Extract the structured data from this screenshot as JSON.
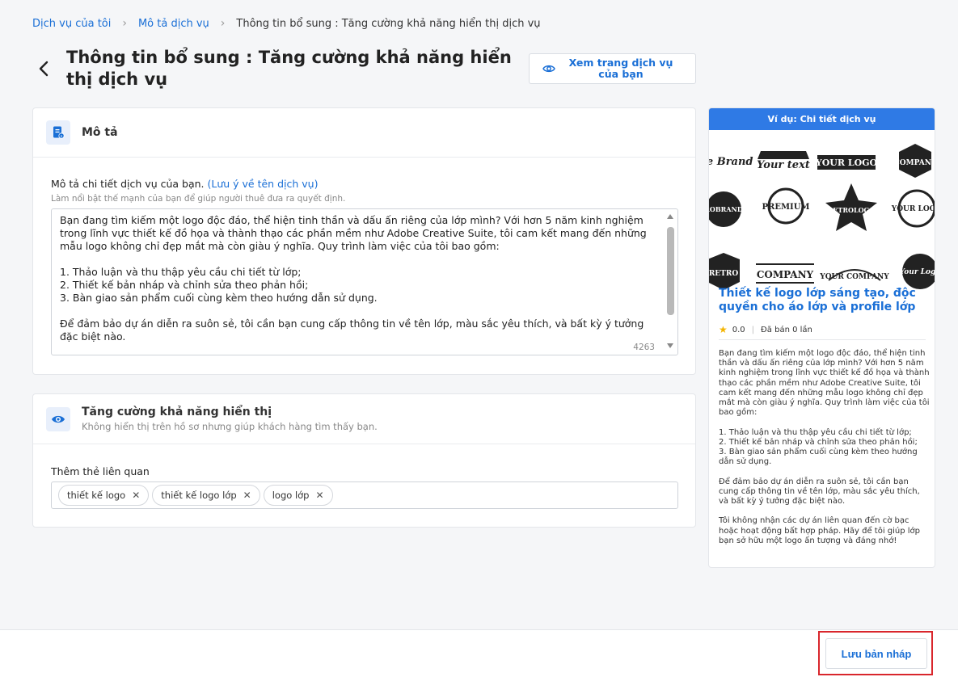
{
  "breadcrumb": {
    "item1": "Dịch vụ của tôi",
    "item2": "Mô tả dịch vụ",
    "current": "Thông tin bổ sung : Tăng cường khả năng hiển thị dịch vụ"
  },
  "header": {
    "title": "Thông tin bổ sung : Tăng cường khả năng hiển thị dịch vụ",
    "view_button": "Xem trang dịch vụ của bạn"
  },
  "description_section": {
    "title": "Mô tả",
    "field_label": "Mô tả chi tiết dịch vụ của bạn.",
    "field_link": "(Lưu ý về tên dịch vụ)",
    "field_hint": "Làm nổi bật thế mạnh của bạn để giúp người thuê đưa ra quyết định.",
    "text": "Bạn đang tìm kiếm một logo độc đáo, thể hiện tinh thần và dấu ấn riêng của lớp mình? Với hơn 5 năm kinh nghiệm trong lĩnh vực thiết kế đồ họa và thành thạo các phần mềm như Adobe Creative Suite, tôi cam kết mang đến những mẫu logo không chỉ đẹp mắt mà còn giàu ý nghĩa. Quy trình làm việc của tôi bao gồm:\n\n1. Thảo luận và thu thập yêu cầu chi tiết từ lớp;\n2. Thiết kế bản nháp và chỉnh sửa theo phản hồi;\n3. Bàn giao sản phẩm cuối cùng kèm theo hướng dẫn sử dụng.\n\nĐể đảm bảo dự án diễn ra suôn sẻ, tôi cần bạn cung cấp thông tin về tên lớp, màu sắc yêu thích, và bất kỳ ý tưởng đặc biệt nào.\n\nTôi không nhận các dự án liên quan đến cờ bạc hoặc hoạt động bất hợp pháp. Hãy để tôi giúp lớp bạn sở hữu một logo ấn tượng và đáng nhớ!",
    "char_count": "4263"
  },
  "visibility_section": {
    "title": "Tăng cường khả năng hiển thị",
    "subtitle": "Không hiển thị trên hồ sơ nhưng giúp khách hàng tìm thấy bạn.",
    "tags_label": "Thêm thẻ liên quan",
    "tags": [
      "thiết kế logo",
      "thiết kế logo lớp",
      "logo lớp"
    ]
  },
  "preview": {
    "header": "Ví dụ: Chi tiết dịch vụ",
    "logo_texts": [
      "the Brand",
      "Your text",
      "YOUR LOGO",
      "COMPANY",
      "ROBRAND",
      "PREMIUM",
      "RETROLOGO",
      "YOUR LOGO",
      "RETRO",
      "COMPANY",
      "YOUR COMPANY",
      "Your Logo"
    ],
    "title": "Thiết kế logo lớp sáng tạo, độc quyền cho áo lớp và profile lớp",
    "rating": "0.0",
    "sold": "Đã bán 0 lần",
    "text": "Bạn đang tìm kiếm một logo độc đáo, thể hiện tinh thần và dấu ấn riêng của lớp mình? Với hơn 5 năm kinh nghiệm trong lĩnh vực thiết kế đồ họa và thành thạo các phần mềm như Adobe Creative Suite, tôi cam kết mang đến những mẫu logo không chỉ đẹp mắt mà còn giàu ý nghĩa. Quy trình làm việc của tôi bao gồm:\n\n1. Thảo luận và thu thập yêu cầu chi tiết từ lớp;\n2. Thiết kế bản nháp và chỉnh sửa theo phản hồi;\n3. Bàn giao sản phẩm cuối cùng kèm theo hướng dẫn sử dụng.\n\nĐể đảm bảo dự án diễn ra suôn sẻ, tôi cần bạn cung cấp thông tin về tên lớp, màu sắc yêu thích, và bất kỳ ý tưởng đặc biệt nào.\n\nTôi không nhận các dự án liên quan đến cờ bạc hoặc hoạt động bất hợp pháp. Hãy để tôi giúp lớp bạn sở hữu một logo ấn tượng và đáng nhớ!"
  },
  "footer": {
    "save_draft": "Lưu bản nháp"
  },
  "colors": {
    "accent": "#1a6fd6",
    "preview_header": "#2f7ae5",
    "highlight_outline": "#d9262c"
  }
}
